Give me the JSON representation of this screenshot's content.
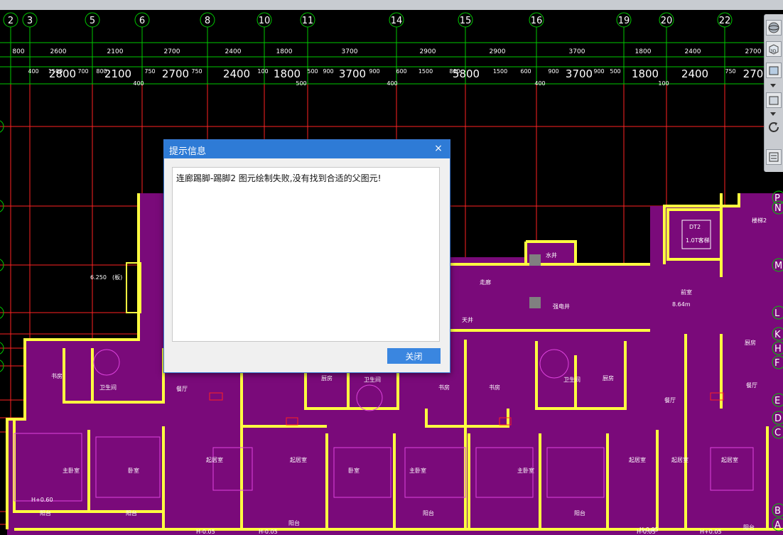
{
  "dialog": {
    "title": "提示信息",
    "message": "连廊踢脚-踢脚2 图元绘制失败,没有找到合适的父图元!",
    "close_button": "关闭",
    "close_icon": "×"
  },
  "drawing": {
    "axis_labels_top": [
      "2",
      "3",
      "5",
      "6",
      "8",
      "10",
      "11",
      "14",
      "15",
      "16",
      "19",
      "20",
      "22"
    ],
    "axis_labels_right": [
      "P",
      "N",
      "M",
      "L",
      "K",
      "H",
      "F",
      "E",
      "D",
      "C",
      "B",
      "A"
    ],
    "dims_row1": [
      "800",
      "2600",
      "2100",
      "2700",
      "2400",
      "1800",
      "3700",
      "2900",
      "2900",
      "3700",
      "1800",
      "2400",
      "2700"
    ],
    "dims_row2_large": [
      "2800",
      "2100",
      "2700",
      "2400",
      "1800",
      "3700",
      "5800",
      "3700",
      "1800",
      "2400",
      "270"
    ],
    "dims_row2_small": [
      "400",
      "1500",
      "700",
      "800",
      "750",
      "750",
      "100",
      "500",
      "900",
      "900",
      "600",
      "1500",
      "800",
      "1500",
      "600",
      "900",
      "900",
      "500",
      "750"
    ],
    "dims_row3_small": [
      "400",
      "500",
      "400",
      "400",
      "100"
    ],
    "elevation_labels": [
      "H+0.60",
      "H-0.05",
      "H-0.05",
      "H-0.05",
      "H-0.05",
      "H+0.05"
    ],
    "room_labels": [
      "书房",
      "卫生间",
      "餐厅",
      "厨房",
      "卫生间",
      "书房",
      "书房",
      "卫生间",
      "厨房",
      "餐厅",
      "厨房",
      "餐厅",
      "主卧室",
      "卧室",
      "起居室",
      "起居室",
      "卧室",
      "主卧室",
      "主卧室",
      "起居室",
      "起居室",
      "起居室",
      "阳台",
      "阳台",
      "阳台",
      "阳台",
      "阳台",
      "阳台",
      "走廊",
      "天井",
      "强电井",
      "水井",
      "前室",
      "DT2",
      "1.0T客梯",
      "楼梯2",
      "6.250",
      "(板)",
      "8.64m"
    ]
  },
  "colors": {
    "background": "#000000",
    "axis": "#00c800",
    "grid": "#ff2020",
    "floor": "#800080",
    "wall": "#ffff40",
    "dialog_title": "#2e7bd6",
    "button": "#3a86e0"
  },
  "icons": [
    "orbit-icon",
    "3d-view-icon",
    "box-view-icon",
    "rotate-icon",
    "settings-view-icon"
  ],
  "toolbar": {
    "view3d_label": "3D"
  }
}
